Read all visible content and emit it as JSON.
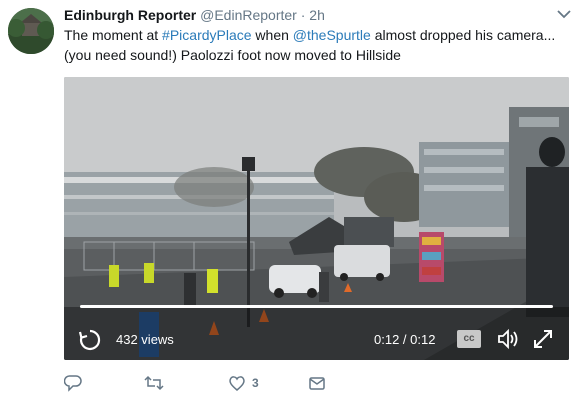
{
  "tweet": {
    "display_name": "Edinburgh Reporter",
    "handle": "@EdinReporter",
    "separator": "·",
    "time": "2h",
    "text_part1": "The moment at ",
    "hashtag": "#PicardyPlace",
    "text_part2": " when ",
    "mention": "@theSpurtle",
    "text_part3": " almost dropped his camera... (you need sound!) Paolozzi foot now moved to Hillside"
  },
  "video": {
    "views": "432 views",
    "timecode": "0:12 / 0:12",
    "cc_label": "cc",
    "progress": 1.0
  },
  "actions": {
    "reply_count": "",
    "retweet_count": "",
    "like_count": "3"
  },
  "colors": {
    "link": "#2b7bb9",
    "muted": "#657786"
  },
  "icons": [
    "chevron-down-icon",
    "replay-icon",
    "volume-icon",
    "fullscreen-icon",
    "reply-icon",
    "retweet-icon",
    "like-icon",
    "message-icon"
  ]
}
